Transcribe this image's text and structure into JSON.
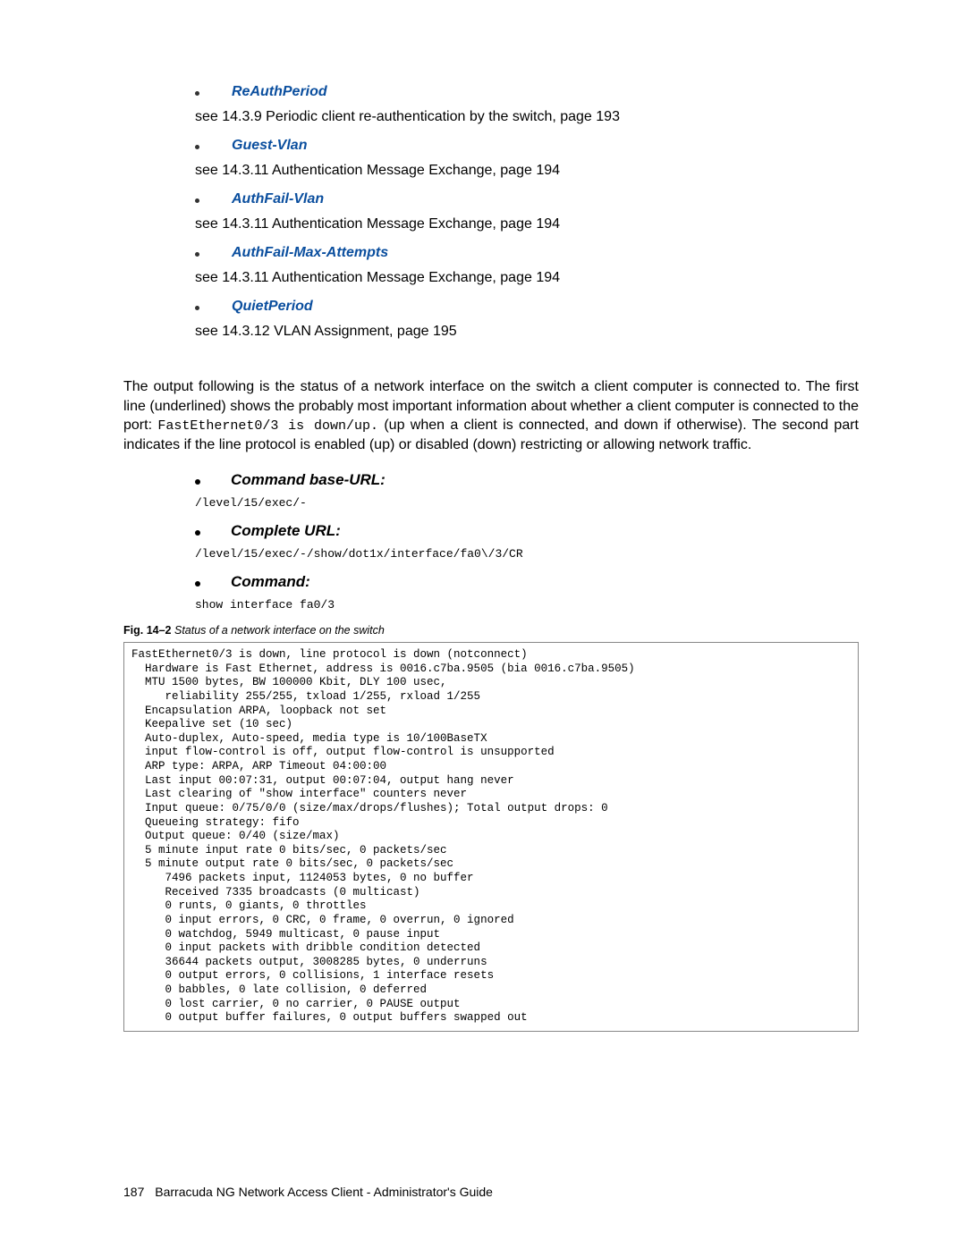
{
  "bullets": [
    {
      "link": "ReAuthPeriod",
      "see": "see 14.3.9 Periodic client re-authentication by the switch, page 193"
    },
    {
      "link": "Guest-Vlan",
      "see": "see 14.3.11 Authentication Message Exchange, page 194"
    },
    {
      "link": "AuthFail-Vlan",
      "see": "see 14.3.11 Authentication Message Exchange, page 194"
    },
    {
      "link": "AuthFail-Max-Attempts",
      "see": "see 14.3.11 Authentication Message Exchange, page 194"
    },
    {
      "link": "QuietPeriod",
      "see": "see 14.3.12 VLAN Assignment, page 195"
    }
  ],
  "paragraph_pre": "The output following is the status of a network interface on the switch a client computer is connected to. The first line (underlined) shows the probably most important information about whether a client computer is connected to the port: ",
  "paragraph_code": "FastEthernet0/3 is down/up.",
  "paragraph_post": " (up when a client is connected, and down if otherwise). The second part indicates if the line protocol is enabled (up) or disabled (down) restricting or allowing network traffic.",
  "cmd_sections": [
    {
      "heading": "Command base-URL:",
      "value": "/level/15/exec/-"
    },
    {
      "heading": "Complete URL:",
      "value": "/level/15/exec/-/show/dot1x/interface/fa0\\/3/CR"
    },
    {
      "heading": "Command:",
      "value": "show interface fa0/3"
    }
  ],
  "figure": {
    "label": "Fig. 14–2",
    "title": "Status of a network interface on the switch"
  },
  "code_output": "FastEthernet0/3 is down, line protocol is down (notconnect)\n  Hardware is Fast Ethernet, address is 0016.c7ba.9505 (bia 0016.c7ba.9505)\n  MTU 1500 bytes, BW 100000 Kbit, DLY 100 usec,\n     reliability 255/255, txload 1/255, rxload 1/255\n  Encapsulation ARPA, loopback not set\n  Keepalive set (10 sec)\n  Auto-duplex, Auto-speed, media type is 10/100BaseTX\n  input flow-control is off, output flow-control is unsupported\n  ARP type: ARPA, ARP Timeout 04:00:00\n  Last input 00:07:31, output 00:07:04, output hang never\n  Last clearing of \"show interface\" counters never\n  Input queue: 0/75/0/0 (size/max/drops/flushes); Total output drops: 0\n  Queueing strategy: fifo\n  Output queue: 0/40 (size/max)\n  5 minute input rate 0 bits/sec, 0 packets/sec\n  5 minute output rate 0 bits/sec, 0 packets/sec\n     7496 packets input, 1124053 bytes, 0 no buffer\n     Received 7335 broadcasts (0 multicast)\n     0 runts, 0 giants, 0 throttles\n     0 input errors, 0 CRC, 0 frame, 0 overrun, 0 ignored\n     0 watchdog, 5949 multicast, 0 pause input\n     0 input packets with dribble condition detected\n     36644 packets output, 3008285 bytes, 0 underruns\n     0 output errors, 0 collisions, 1 interface resets\n     0 babbles, 0 late collision, 0 deferred\n     0 lost carrier, 0 no carrier, 0 PAUSE output\n     0 output buffer failures, 0 output buffers swapped out",
  "footer": {
    "page": "187",
    "title": "Barracuda NG Network Access Client - Administrator's Guide"
  }
}
